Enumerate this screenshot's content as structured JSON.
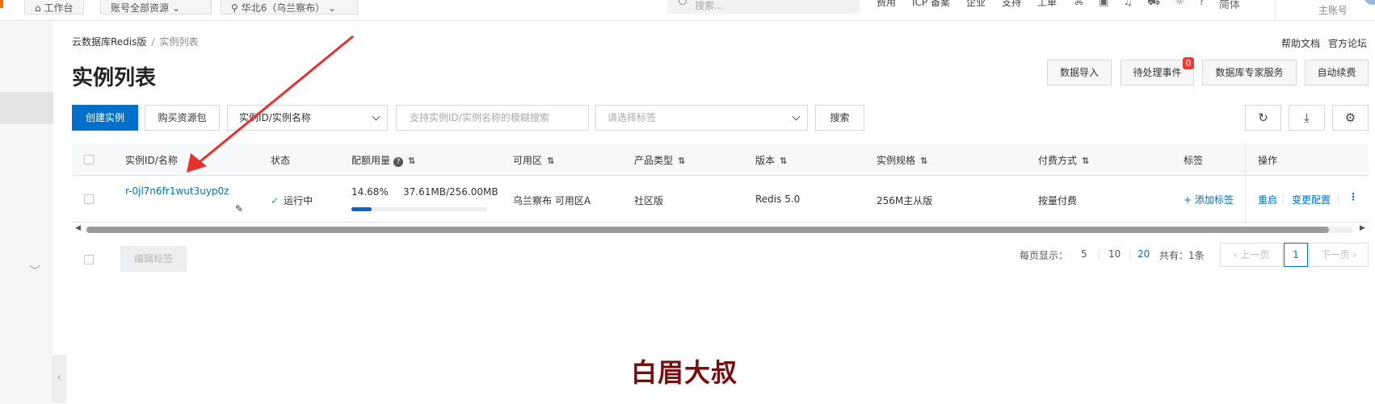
{
  "topnav": {
    "workbench": "工作台",
    "resource_group": "账号全部资源",
    "region": "华北6（乌兰察布）",
    "search_placeholder": "搜索...",
    "links": [
      "费用",
      "ICP 备案",
      "企业",
      "支持",
      "工单"
    ],
    "lang": "简体",
    "account": "主账号"
  },
  "breadcrumb": {
    "root": "云数据库Redis版",
    "separator": "/",
    "current": "实例列表"
  },
  "help": {
    "docs": "帮助文档",
    "forum": "官方论坛"
  },
  "page_title": "实例列表",
  "header_buttons": {
    "import": "数据导入",
    "pending": "待处理事件",
    "pending_count": "0",
    "expert": "数据库专家服务",
    "renew": "自动续费"
  },
  "toolbar": {
    "create": "创建实例",
    "buy_pack": "购买资源包",
    "filter_select": "实例ID/实例名称",
    "search_placeholder": "支持实例ID/实例名称的模糊搜索",
    "tag_placeholder": "请选择标签",
    "search": "搜索"
  },
  "table": {
    "headers": {
      "id_name": "实例ID/名称",
      "status": "状态",
      "quota": "配额用量",
      "zone": "可用区",
      "product": "产品类型",
      "version": "版本",
      "spec": "实例规格",
      "billing": "付费方式",
      "tags": "标签",
      "ops": "操作"
    },
    "row": {
      "id": "r-0jl7n6fr1wut3uyp0z",
      "status": "运行中",
      "quota_percent_text": "14.68%",
      "quota_fraction": 0.1468,
      "quota_usage": "37.61MB/256.00MB",
      "zone": "乌兰察布 可用区A",
      "product": "社区版",
      "version": "Redis 5.0",
      "spec": "256M主从版",
      "billing": "按量付费",
      "add_tag": "添加标签",
      "restart": "重启",
      "change_config": "变更配置"
    }
  },
  "footer": {
    "edit_tags": "编辑标签",
    "per_page_label": "每页显示：",
    "per_page_options": [
      "5",
      "10",
      "20"
    ],
    "per_page_selected": "20",
    "total": "共有：1条",
    "prev": "上一页",
    "current_page": "1",
    "next": "下一页"
  },
  "watermark": "白眉大叔",
  "colors": {
    "primary": "#0070cc",
    "annotation_arrow": "#e8312f",
    "watermark": "#7a0e0e",
    "running": "#1aaa55"
  }
}
